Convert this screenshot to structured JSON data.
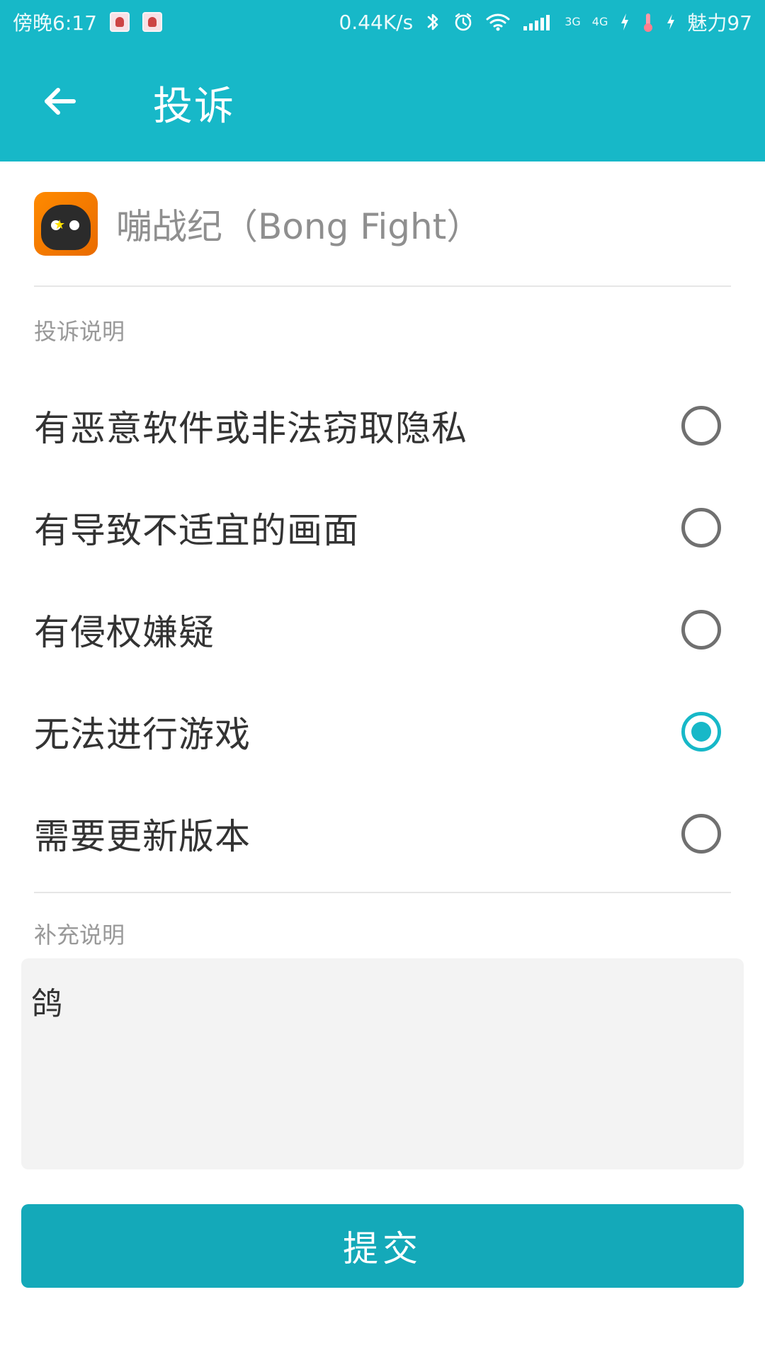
{
  "status_bar": {
    "carrier": "傍晚6:17",
    "network_speed": "0.44K/s",
    "signal_small_top": "3G",
    "signal_small_bottom": "4G",
    "battery_label": "魅力97",
    "colors": {
      "background": "#17b8c8",
      "text": "#ffffff"
    },
    "icons": [
      "thumb-image-1-icon",
      "thumb-image-2-icon",
      "bluetooth-icon",
      "alarm-icon",
      "wifi-icon",
      "signal-bars-icon",
      "charging-bolt-icon",
      "temperature-icon",
      "charging-bolt-icon-2"
    ]
  },
  "appbar": {
    "title": "投诉",
    "back_icon": "back-arrow-icon",
    "background": "#17b8c8"
  },
  "app": {
    "name": "嘣战纪（Bong Fight）",
    "icon": "game-app-icon"
  },
  "complaint": {
    "section_label": "投诉说明",
    "options": [
      {
        "label": "有恶意软件或非法窃取隐私",
        "selected": false
      },
      {
        "label": "有导致不适宜的画面",
        "selected": false
      },
      {
        "label": "有侵权嫌疑",
        "selected": false
      },
      {
        "label": "无法进行游戏",
        "selected": true
      },
      {
        "label": "需要更新版本",
        "selected": false
      }
    ],
    "accent_color": "#17b8c8"
  },
  "supplement": {
    "section_label": "补充说明",
    "text": "鸽"
  },
  "submit": {
    "label": "提交",
    "color": "#14a9b9"
  }
}
